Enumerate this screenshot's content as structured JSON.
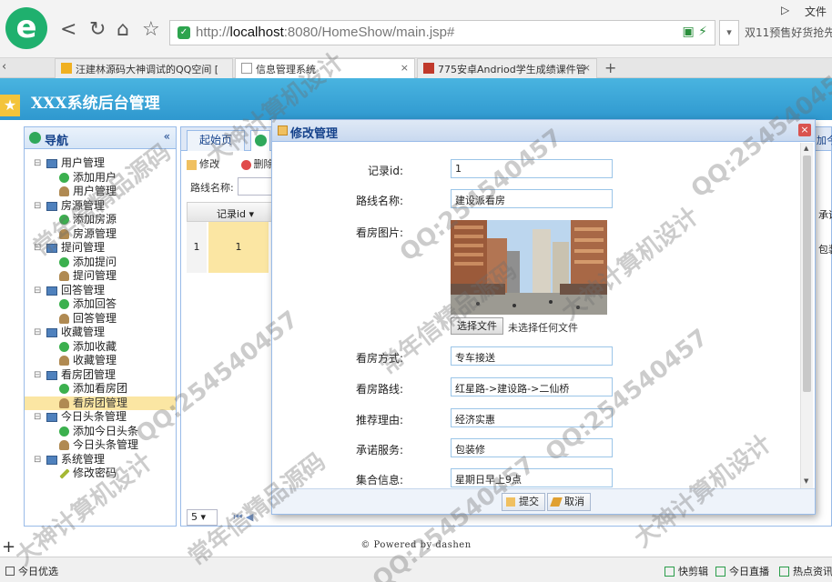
{
  "browser": {
    "logo_letter": "e",
    "back_icon": "<",
    "refresh_icon": "↻",
    "home_icon": "⌂",
    "star_icon": "☆",
    "url_prefix": "http://",
    "url_host": "localhost",
    "url_rest": ":8080/HomeShow/main.jsp#",
    "url_tools": "▣ ⚡",
    "url_dropdown": "▾",
    "promo": "双11预售好货抢先",
    "win_ctl": "▷",
    "file_menu": "文件",
    "tabs": [
      {
        "label": "汪建林源码大神调试的QQ空间 [",
        "color": "#f0b020"
      },
      {
        "label": "信息管理系统",
        "color": "#999999"
      },
      {
        "label": "775安卓Andriod学生成绩课件管",
        "color": "#c0392b"
      }
    ],
    "tab_close": "×",
    "tab_back": "‹",
    "new_tab": "+"
  },
  "app": {
    "title": "XXX系统后台管理",
    "star": "★",
    "footer": "© Powered by dashen"
  },
  "nav": {
    "title": "导航",
    "collapse": "«",
    "groups": [
      {
        "label": "用户管理",
        "items": [
          {
            "label": "添加用户",
            "type": "add"
          },
          {
            "label": "用户管理",
            "type": "mgr"
          }
        ]
      },
      {
        "label": "房源管理",
        "items": [
          {
            "label": "添加房源",
            "type": "add"
          },
          {
            "label": "房源管理",
            "type": "mgr"
          }
        ]
      },
      {
        "label": "提问管理",
        "items": [
          {
            "label": "添加提问",
            "type": "add"
          },
          {
            "label": "提问管理",
            "type": "mgr"
          }
        ]
      },
      {
        "label": "回答管理",
        "items": [
          {
            "label": "添加回答",
            "type": "add"
          },
          {
            "label": "回答管理",
            "type": "mgr"
          }
        ]
      },
      {
        "label": "收藏管理",
        "items": [
          {
            "label": "添加收藏",
            "type": "add"
          },
          {
            "label": "收藏管理",
            "type": "mgr"
          }
        ]
      },
      {
        "label": "看房团管理",
        "items": [
          {
            "label": "添加看房团",
            "type": "add"
          },
          {
            "label": "看房团管理",
            "type": "mgr",
            "selected": true
          }
        ]
      },
      {
        "label": "今日头条管理",
        "items": [
          {
            "label": "添加今日头条",
            "type": "add"
          },
          {
            "label": "今日头条管理",
            "type": "mgr"
          }
        ]
      },
      {
        "label": "系统管理",
        "items": [
          {
            "label": "修改密码",
            "type": "pen"
          }
        ]
      }
    ]
  },
  "content": {
    "tab_start": "起始页",
    "edit": "修改",
    "delete": "删除",
    "search_label": "路线名称:",
    "col_id": "记录id",
    "sort_icon": "▾",
    "row_num": "1",
    "row_id": "1",
    "page_size": "5",
    "page_nav": "⏮  ◀",
    "right_cut_tab": "加今",
    "right_cut_col": "承诺",
    "right_cut_val": "包装"
  },
  "modal": {
    "title": "修改管理",
    "close": "×",
    "fields": [
      {
        "label": "记录id:",
        "value": "1"
      },
      {
        "label": "路线名称:",
        "value": "建设派看房"
      },
      {
        "label": "看房方式:",
        "value": "专车接送"
      },
      {
        "label": "看房路线:",
        "value": "红星路->建设路->二仙桥"
      },
      {
        "label": "推荐理由:",
        "value": "经济实惠"
      },
      {
        "label": "承诺服务:",
        "value": "包装修"
      },
      {
        "label": "集合信息:",
        "value": "星期日早上9点"
      }
    ],
    "photo_label": "看房图片:",
    "choose_file": "选择文件",
    "no_file": "未选择任何文件",
    "submit": "提交",
    "cancel": "取消",
    "scroll_up": "▲",
    "scroll_down": "▼"
  },
  "statusbar": {
    "left": "今日优选",
    "items": [
      "快剪辑",
      "今日直播",
      "热点资讯"
    ]
  },
  "watermarks": [
    "大神计算机设计",
    "QQ:254540457",
    "常年信精品源码",
    "大神计算机设计",
    "QQ:254540457",
    "常年信精品源码",
    "QQ:254540457",
    "大神计算机设计",
    "常年信精品源码",
    "QQ:254540457",
    "大神计算机设计",
    "QQ:254540457"
  ]
}
